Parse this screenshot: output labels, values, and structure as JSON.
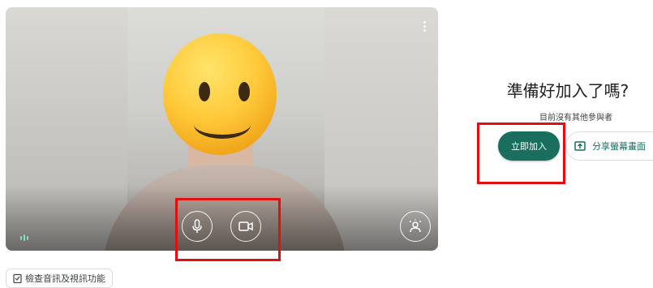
{
  "preview": {
    "mic_icon": "microphone-icon",
    "camera_icon": "videocam-icon",
    "effects_icon": "visual-effects-icon",
    "menu_icon": "more-vert-icon"
  },
  "check_button": {
    "label": "檢查音訊及視訊功能"
  },
  "join_panel": {
    "title": "準備好加入了嗎?",
    "subtitle": "目前沒有其他參與者",
    "join_label": "立即加入",
    "share_label": "分享螢幕畫面"
  },
  "colors": {
    "join_button": "#1a6e5e",
    "highlight": "#e01010"
  }
}
